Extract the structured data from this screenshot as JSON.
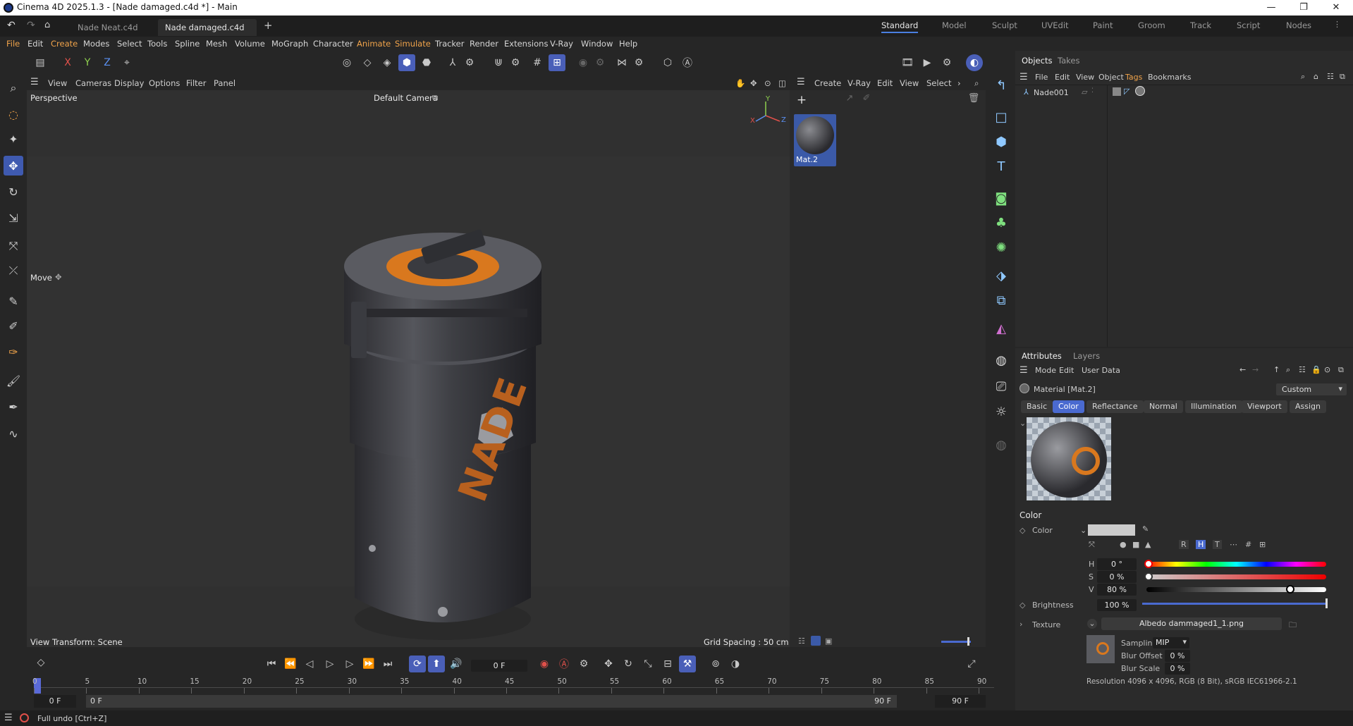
{
  "window": {
    "title": "Cinema 4D 2025.1.3 - [Nade damaged.c4d *] - Main",
    "controls": [
      "—",
      "❐",
      "✕"
    ]
  },
  "doc_tabs": [
    {
      "label": "Nade Neat.c4d"
    },
    {
      "label": "Nade damaged.c4d *"
    }
  ],
  "layouts": [
    "Standard",
    "Model",
    "Sculpt",
    "UVEdit",
    "Paint",
    "Groom",
    "Track",
    "Script",
    "Nodes"
  ],
  "menus": [
    "File",
    "Edit",
    "Create",
    "Modes",
    "Select",
    "Tools",
    "Spline",
    "Mesh",
    "Volume",
    "MoGraph",
    "Character",
    "Animate",
    "Simulate",
    "Tracker",
    "Render",
    "Extensions",
    "V-Ray",
    "Window",
    "Help"
  ],
  "toolbar": {
    "axes": [
      "X",
      "Y",
      "Z"
    ]
  },
  "viewport": {
    "menu": [
      "View",
      "Cameras",
      "Display",
      "Options",
      "Filter",
      "Panel"
    ],
    "label": "Perspective",
    "camera": "Default Camera",
    "tool_hint": "Move",
    "view_transform": "View Transform: Scene",
    "grid_spacing": "Grid Spacing : 50 cm",
    "axis_labels": {
      "x": "X",
      "y": "Y",
      "z": "Z"
    },
    "model_text": "NADE"
  },
  "material_manager": {
    "menu": [
      "Create",
      "V-Ray",
      "Edit",
      "View",
      "Select"
    ],
    "materials": [
      {
        "name": "Mat.2"
      }
    ]
  },
  "objects_panel": {
    "tabs": [
      "Objects",
      "Takes"
    ],
    "menu": [
      "File",
      "Edit",
      "View",
      "Object",
      "Tags",
      "Bookmarks"
    ],
    "objects": [
      {
        "name": "Nade001"
      }
    ]
  },
  "attributes_panel": {
    "tabs": [
      "Attributes",
      "Layers"
    ],
    "menu": [
      "Mode",
      "Edit",
      "User Data"
    ],
    "title": "Material [Mat.2]",
    "preset": "Custom",
    "sub_tabs": [
      "Basic",
      "Color",
      "Reflectance",
      "Normal",
      "Illumination",
      "Viewport",
      "Assign"
    ],
    "section": "Color",
    "color_label": "Color",
    "mode_buttons": [
      "R",
      "H",
      "T",
      "#"
    ],
    "h": {
      "label": "H",
      "value": "0 °"
    },
    "s": {
      "label": "S",
      "value": "0 %"
    },
    "v": {
      "label": "V",
      "value": "80 %",
      "level": 0.8
    },
    "brightness": {
      "label": "Brightness",
      "value": "100 %",
      "level": 1.0
    },
    "texture": {
      "label": "Texture",
      "file": "Albedo dammaged1_1.png"
    },
    "sampling": {
      "label": "Sampling",
      "value": "MIP"
    },
    "blur_offset": {
      "label": "Blur Offset",
      "value": "0 %"
    },
    "blur_scale": {
      "label": "Blur Scale",
      "value": "0 %"
    },
    "resolution": "Resolution 4096 x 4096, RGB (8 Bit), sRGB IEC61966-2.1"
  },
  "timeline": {
    "current_frame": "0 F",
    "ticks": [
      "0",
      "5",
      "10",
      "15",
      "20",
      "25",
      "30",
      "35",
      "40",
      "45",
      "50",
      "55",
      "60",
      "65",
      "70",
      "75",
      "80",
      "85",
      "90"
    ],
    "start": "0 F",
    "start2": "0 F",
    "end": "90 F",
    "end2": "90 F"
  },
  "status": {
    "text": "Full undo [Ctrl+Z]"
  },
  "colors": {
    "accent": "#4a6ad0",
    "orange": "#d9781e"
  }
}
